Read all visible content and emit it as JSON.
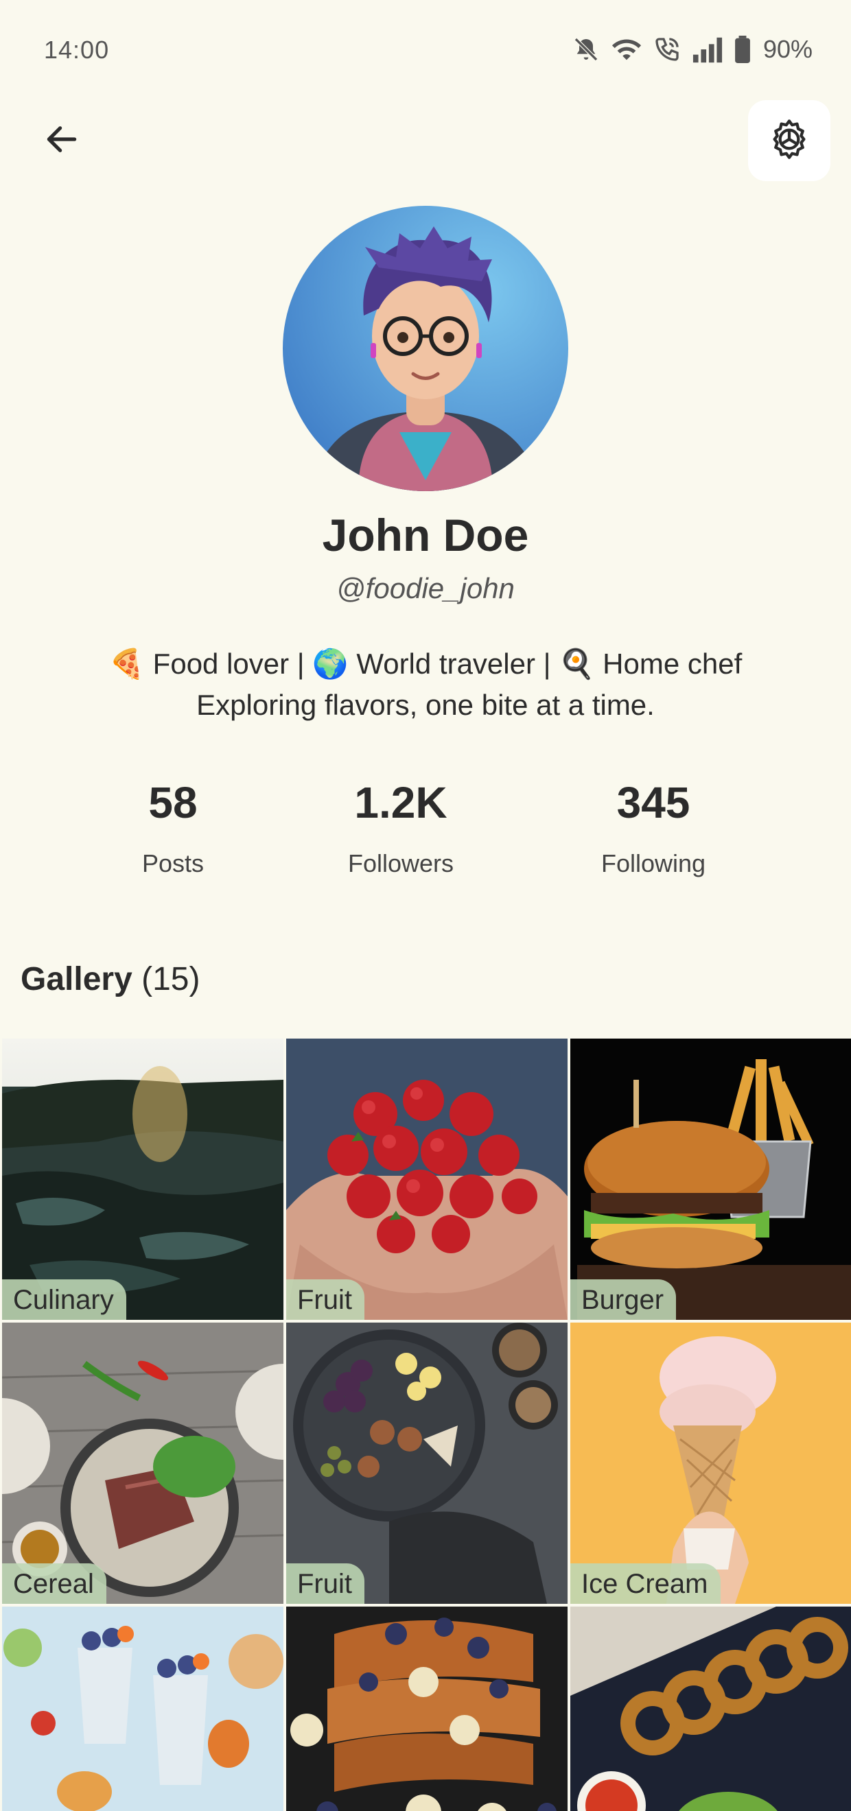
{
  "status_bar": {
    "time": "14:00",
    "battery": "90%",
    "icons": [
      "mute-icon",
      "wifi-icon",
      "wifi-calling-icon",
      "signal-icon",
      "battery-icon"
    ]
  },
  "top_bar": {
    "back_icon": "arrow-left-icon",
    "settings_icon": "gear-icon"
  },
  "profile": {
    "name": "John Doe",
    "handle": "@foodie_john",
    "bio_line1": "🍕 Food lover | 🌍 World traveler | 🍳 Home chef",
    "bio_line2": "Exploring flavors, one bite at a time."
  },
  "stats": [
    {
      "value": "58",
      "label": "Posts"
    },
    {
      "value": "1.2K",
      "label": "Followers"
    },
    {
      "value": "345",
      "label": "Following"
    }
  ],
  "gallery": {
    "title": "Gallery",
    "count": "(15)",
    "items": [
      {
        "label": "Culinary"
      },
      {
        "label": "Fruit"
      },
      {
        "label": "Burger"
      },
      {
        "label": "Cereal"
      },
      {
        "label": "Fruit"
      },
      {
        "label": "Ice Cream"
      },
      {
        "label": ""
      },
      {
        "label": ""
      },
      {
        "label": ""
      }
    ]
  },
  "colors": {
    "background": "#faf9ee",
    "label_chip": "#bed7b4",
    "text": "#2b2b2b"
  }
}
